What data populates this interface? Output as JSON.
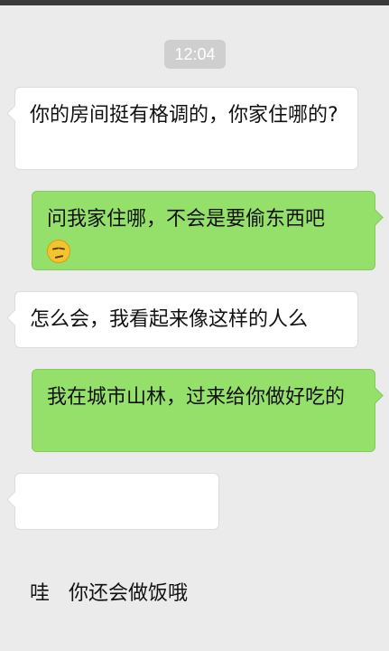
{
  "header": {
    "timestamp": "12:04"
  },
  "messages": [
    {
      "side": "in",
      "text": "你的房间挺有格调的，你家住哪的?"
    },
    {
      "side": "out",
      "text": "问我家住哪，不会是要偷东西吧",
      "emoji": "smirk-emoji"
    },
    {
      "side": "in",
      "text": "怎么会，我看起来像这样的人么"
    },
    {
      "side": "out",
      "text": "我在城市山林，过来给你做好吃的"
    },
    {
      "side": "in",
      "text": "哇   你还会做饭哦"
    }
  ],
  "colors": {
    "incoming_bubble": "#ffffff",
    "outgoing_bubble": "#95e06a",
    "background": "#ebebeb"
  }
}
